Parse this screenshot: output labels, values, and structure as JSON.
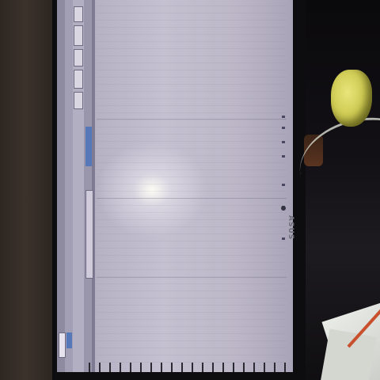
{
  "scene": {
    "description_type": "photo-of-monitor",
    "colors": {
      "screen_base": "#b8b4c6",
      "glare": "#fffff5",
      "bezel": "#0d0d10",
      "flower": "#e8e57a",
      "pencil": "#c8502d",
      "accent_blue": "#5677b8"
    }
  },
  "monitor": {
    "brand_logo": "ASUS"
  },
  "screen_texts": {
    "toolbar_rotated_1": "",
    "toolbar_rotated_2": ""
  }
}
